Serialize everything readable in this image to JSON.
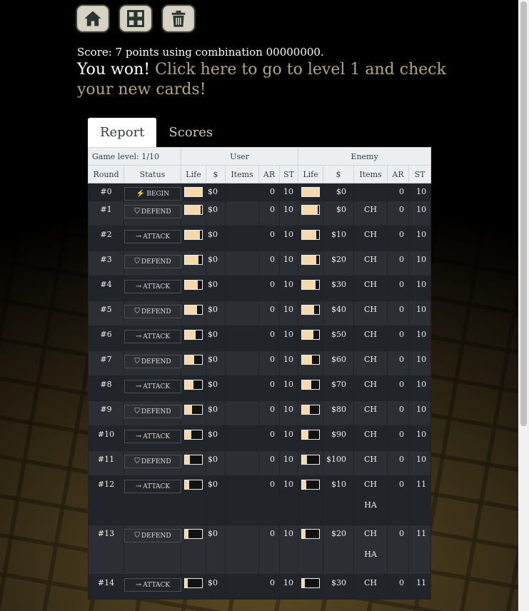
{
  "toolbar": {
    "home": "home-icon",
    "grid": "grid-icon",
    "trash": "trash-icon"
  },
  "score_text": "Score: 7 points using combination 00000000.",
  "won": {
    "prefix": "You won!",
    "link": "Click here to go to level 1 and check your new cards!"
  },
  "tabs": [
    "Report",
    "Scores"
  ],
  "header": {
    "game_level": "Game level: 1/10",
    "user": "User",
    "enemy": "Enemy",
    "cols": [
      "Round",
      "Status",
      "Life",
      "$",
      "Items",
      "AR",
      "ST",
      "Life",
      "$",
      "Items",
      "AR",
      "ST"
    ]
  },
  "status_icons": {
    "BEGIN": "⚡",
    "DEFEND": "⛉",
    "ATTACK": "→"
  },
  "rows": [
    {
      "round": "#0",
      "status": "BEGIN",
      "u_life": 1.0,
      "u_cash": "$0",
      "u_items": [],
      "u_ar": "0",
      "u_st": "10",
      "e_life": 1.0,
      "e_cash": "$0",
      "e_items": [],
      "e_ar": "0",
      "e_st": "10"
    },
    {
      "round": "#1",
      "status": "DEFEND",
      "u_life": 0.92,
      "u_cash": "$0",
      "u_items": [],
      "u_ar": "0",
      "u_st": "10",
      "e_life": 0.92,
      "e_cash": "$0",
      "e_items": [
        "CH"
      ],
      "e_ar": "0",
      "e_st": "10"
    },
    {
      "round": "#2",
      "status": "ATTACK",
      "u_life": 0.88,
      "u_cash": "$0",
      "u_items": [],
      "u_ar": "0",
      "u_st": "10",
      "e_life": 0.85,
      "e_cash": "$10",
      "e_items": [
        "CH"
      ],
      "e_ar": "0",
      "e_st": "10"
    },
    {
      "round": "#3",
      "status": "DEFEND",
      "u_life": 0.8,
      "u_cash": "$0",
      "u_items": [],
      "u_ar": "0",
      "u_st": "10",
      "e_life": 0.85,
      "e_cash": "$20",
      "e_items": [
        "CH"
      ],
      "e_ar": "0",
      "e_st": "10"
    },
    {
      "round": "#4",
      "status": "ATTACK",
      "u_life": 0.75,
      "u_cash": "$0",
      "u_items": [],
      "u_ar": "0",
      "u_st": "10",
      "e_life": 0.78,
      "e_cash": "$30",
      "e_items": [
        "CH"
      ],
      "e_ar": "0",
      "e_st": "10"
    },
    {
      "round": "#5",
      "status": "DEFEND",
      "u_life": 0.7,
      "u_cash": "$0",
      "u_items": [],
      "u_ar": "0",
      "u_st": "10",
      "e_life": 0.7,
      "e_cash": "$40",
      "e_items": [
        "CH"
      ],
      "e_ar": "0",
      "e_st": "10"
    },
    {
      "round": "#6",
      "status": "ATTACK",
      "u_life": 0.62,
      "u_cash": "$0",
      "u_items": [],
      "u_ar": "0",
      "u_st": "10",
      "e_life": 0.65,
      "e_cash": "$50",
      "e_items": [
        "CH"
      ],
      "e_ar": "0",
      "e_st": "10"
    },
    {
      "round": "#7",
      "status": "DEFEND",
      "u_life": 0.55,
      "u_cash": "$0",
      "u_items": [],
      "u_ar": "0",
      "u_st": "10",
      "e_life": 0.6,
      "e_cash": "$60",
      "e_items": [
        "CH"
      ],
      "e_ar": "0",
      "e_st": "10"
    },
    {
      "round": "#8",
      "status": "ATTACK",
      "u_life": 0.5,
      "u_cash": "$0",
      "u_items": [],
      "u_ar": "0",
      "u_st": "10",
      "e_life": 0.52,
      "e_cash": "$70",
      "e_items": [
        "CH"
      ],
      "e_ar": "0",
      "e_st": "10"
    },
    {
      "round": "#9",
      "status": "DEFEND",
      "u_life": 0.42,
      "u_cash": "$0",
      "u_items": [],
      "u_ar": "0",
      "u_st": "10",
      "e_life": 0.45,
      "e_cash": "$80",
      "e_items": [
        "CH"
      ],
      "e_ar": "0",
      "e_st": "10"
    },
    {
      "round": "#10",
      "status": "ATTACK",
      "u_life": 0.38,
      "u_cash": "$0",
      "u_items": [],
      "u_ar": "0",
      "u_st": "10",
      "e_life": 0.38,
      "e_cash": "$90",
      "e_items": [
        "CH"
      ],
      "e_ar": "0",
      "e_st": "10"
    },
    {
      "round": "#11",
      "status": "DEFEND",
      "u_life": 0.3,
      "u_cash": "$0",
      "u_items": [],
      "u_ar": "0",
      "u_st": "10",
      "e_life": 0.3,
      "e_cash": "$100",
      "e_items": [
        "CH"
      ],
      "e_ar": "0",
      "e_st": "10"
    },
    {
      "round": "#12",
      "status": "ATTACK",
      "u_life": 0.25,
      "u_cash": "$0",
      "u_items": [],
      "u_ar": "0",
      "u_st": "10",
      "e_life": 0.25,
      "e_cash": "$10",
      "e_items": [
        "CH",
        "HA"
      ],
      "e_ar": "0",
      "e_st": "11"
    },
    {
      "round": "#13",
      "status": "DEFEND",
      "u_life": 0.2,
      "u_cash": "$0",
      "u_items": [],
      "u_ar": "0",
      "u_st": "10",
      "e_life": 0.2,
      "e_cash": "$20",
      "e_items": [
        "CH",
        "HA"
      ],
      "e_ar": "0",
      "e_st": "11"
    },
    {
      "round": "#14",
      "status": "ATTACK",
      "u_life": 0.15,
      "u_cash": "$0",
      "u_items": [],
      "u_ar": "0",
      "u_st": "10",
      "e_life": 0.15,
      "e_cash": "$30",
      "e_items": [
        "CH"
      ],
      "e_ar": "0",
      "e_st": "11"
    }
  ]
}
